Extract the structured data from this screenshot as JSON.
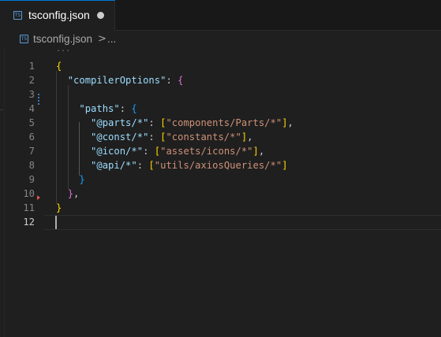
{
  "tab": {
    "title": "tsconfig.json",
    "icon": "ts-file-icon",
    "modified": true
  },
  "breadcrumb": {
    "file": "tsconfig.json",
    "separator": ">",
    "more": "..."
  },
  "editor": {
    "fold_placeholder": "...",
    "line_numbers": [
      "1",
      "2",
      "3",
      "4",
      "5",
      "6",
      "7",
      "8",
      "9",
      "10",
      "11",
      "12"
    ],
    "active_line": "12",
    "code": {
      "l1_brace": "{",
      "l2_key": "\"compilerOptions\"",
      "l2_colon": ": ",
      "l2_brace": "{",
      "l4_key": "\"paths\"",
      "l4_colon": ": ",
      "l4_brace": "{",
      "l5_key": "\"@parts/*\"",
      "l5_colon": ": ",
      "l5_open": "[",
      "l5_val": "\"components/Parts/*\"",
      "l5_close": "]",
      "l5_comma": ",",
      "l6_key": "\"@const/*\"",
      "l6_colon": ": ",
      "l6_open": "[",
      "l6_val": "\"constants/*\"",
      "l6_close": "]",
      "l6_comma": ",",
      "l7_key": "\"@icon/*\"",
      "l7_colon": ": ",
      "l7_open": "[",
      "l7_val": "\"assets/icons/*\"",
      "l7_close": "]",
      "l7_comma": ",",
      "l8_key": "\"@api/*\"",
      "l8_colon": ": ",
      "l8_open": "[",
      "l8_val": "\"utils/axiosQueries/*\"",
      "l8_close": "]",
      "l9_brace": "}",
      "l10_brace": "}",
      "l10_comma": ",",
      "l11_brace": "}"
    }
  },
  "colors": {
    "background": "#1f1f1f",
    "key": "#9cdcfe",
    "string": "#ce9178",
    "bracket_level1": "#ffd700",
    "bracket_level2": "#da70d6",
    "bracket_level3": "#179fff",
    "line_number": "#858585"
  }
}
